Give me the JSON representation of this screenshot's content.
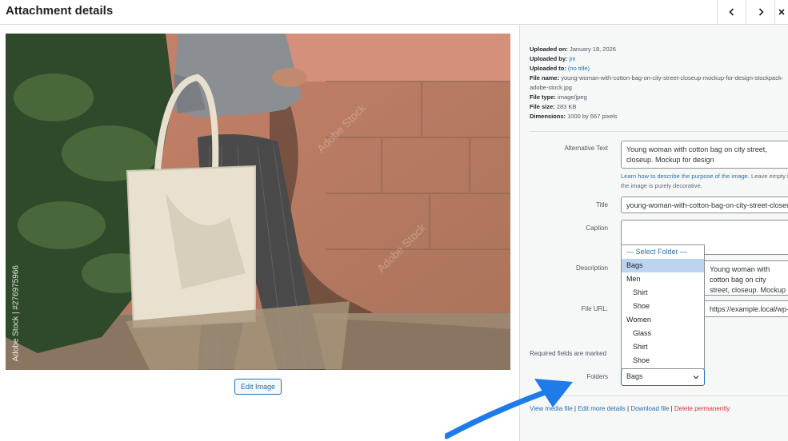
{
  "header": {
    "title": "Attachment details",
    "prev_icon": "chevron-left-icon",
    "next_icon": "chevron-right-icon",
    "close_icon": "close-icon"
  },
  "image": {
    "watermark_vertical": "Adobe Stock | #276975966",
    "edit_label": "Edit Image"
  },
  "meta": {
    "uploaded_on_label": "Uploaded on:",
    "uploaded_on": "January 18, 2026",
    "uploaded_by_label": "Uploaded by:",
    "uploaded_by": "jm",
    "uploaded_to_label": "Uploaded to:",
    "uploaded_to": "(no title)",
    "file_name_label": "File name:",
    "file_name": "young-woman-with-cotton-bag-on-city-street-closeup-mockup-for-design-stockpack-adobe-stock.jpg",
    "file_type_label": "File type:",
    "file_type": "image/jpeg",
    "file_size_label": "File size:",
    "file_size": "283 KB",
    "dimensions_label": "Dimensions:",
    "dimensions": "1000 by 667 pixels"
  },
  "fields": {
    "alt_label": "Alternative Text",
    "alt_value": "Young woman with cotton bag on city street, closeup. Mockup for design",
    "alt_help_link": "Learn how to describe the purpose of the image.",
    "alt_help_text": " Leave empty if the image is purely decorative.",
    "title_label": "Title",
    "title_value": "young-woman-with-cotton-bag-on-city-street-closeup-mockup-for-design",
    "caption_label": "Caption",
    "caption_value": "",
    "description_label": "Description",
    "description_value": "Young woman with cotton bag on city street, closeup. Mockup for design",
    "file_url_label": "File URL:",
    "file_url_value": "https://example.local/wp-content/uploads/young-woman.jpg",
    "required_note": "Required fields are marked",
    "folders_label": "Folders",
    "folders_value": "Bags"
  },
  "dropdown": {
    "options": [
      {
        "label": "— Select Folder —"
      },
      {
        "label": "Bags"
      },
      {
        "label": "Men"
      },
      {
        "label": "Shirt"
      },
      {
        "label": "Shoe"
      },
      {
        "label": "Women"
      },
      {
        "label": "Glass"
      },
      {
        "label": "Shirt"
      },
      {
        "label": "Shoe"
      }
    ]
  },
  "actions": {
    "view": "View media file",
    "edit": "Edit more details",
    "download": "Download file",
    "delete": "Delete permanently",
    "sep": " | "
  },
  "colors": {
    "accent": "#2271b1",
    "danger": "#d63638",
    "arrow": "#1e7be8",
    "dropdown_selected": "#bcd4f0"
  }
}
